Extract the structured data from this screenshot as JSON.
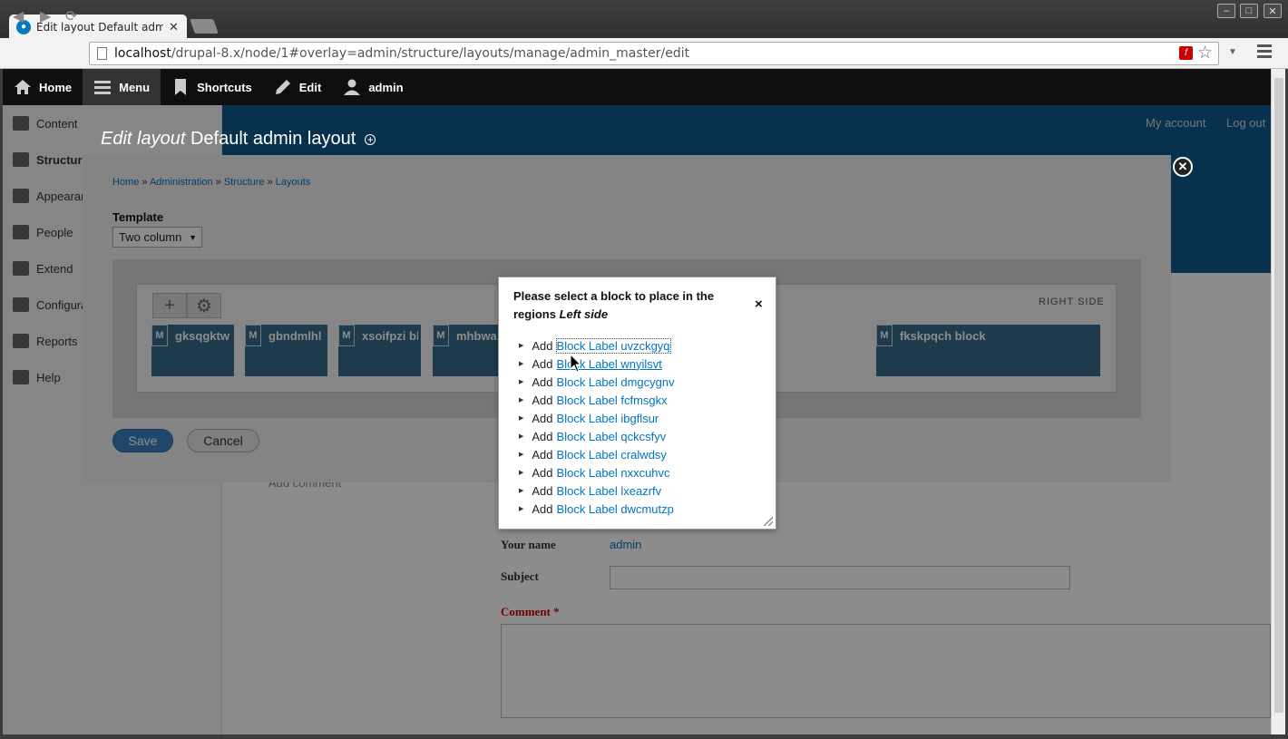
{
  "browser": {
    "tab_title": "Edit layout Default admin",
    "url_host": "localhost",
    "url_path": "/drupal-8.x/node/1#overlay=admin/structure/layouts/manage/admin_master/edit"
  },
  "admin_toolbar": {
    "home": "Home",
    "menu": "Menu",
    "shortcuts": "Shortcuts",
    "edit": "Edit",
    "user": "admin"
  },
  "background": {
    "sidebar": [
      "Content",
      "Structure",
      "Appearance",
      "People",
      "Extend",
      "Configuration",
      "Reports",
      "Help"
    ],
    "header_links": [
      "My account",
      "Log out"
    ],
    "add_comment": "Add comment",
    "your_name_label": "Your name",
    "your_name_value": "admin",
    "subject_label": "Subject",
    "comment_label": "Comment *"
  },
  "overlay": {
    "title_prefix": "Edit layout",
    "title_name": "Default admin layout",
    "breadcrumb": [
      "Home",
      "Administration",
      "Structure",
      "Layouts"
    ],
    "template_label": "Template",
    "template_value": "Two column",
    "region_right": "RIGHT SIDE",
    "block_badge": "M",
    "blocks": [
      "gksqgktw block",
      "gbndmlhl",
      "xsoifpzi block",
      "mhbwa",
      "fkskpqch block"
    ],
    "save": "Save",
    "cancel": "Cancel"
  },
  "dialog": {
    "title_text": "Please select a block to place in the regions",
    "title_region": "Left side",
    "close": "×",
    "add_word": "Add",
    "items": [
      "Block Label uvzckgyq",
      "Block Label wnyilsvt",
      "Block Label dmgcygnv",
      "Block Label fcfmsgkx",
      "Block Label ibgflsur",
      "Block Label qckcsfyv",
      "Block Label cralwdsy",
      "Block Label nxxcuhvc",
      "Block Label lxeazrfv",
      "Block Label dwcmutzp"
    ]
  }
}
